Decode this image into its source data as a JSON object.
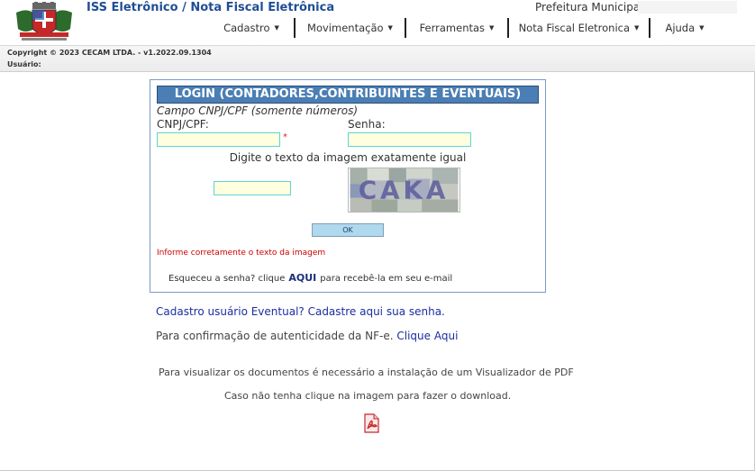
{
  "header": {
    "app_title": "ISS Eletrônico / Nota Fiscal Eletrônica",
    "prefeitura_label": "Prefeitura Municipal",
    "menu": [
      {
        "label": "Cadastro"
      },
      {
        "label": "Movimentação"
      },
      {
        "label": "Ferramentas"
      },
      {
        "label": "Nota Fiscal Eletronica"
      },
      {
        "label": "Ajuda"
      }
    ]
  },
  "statusbar": {
    "copyright": "Copyright © 2023 CECAM LTDA. - v1.2022.09.1304",
    "user_label": "Usuário:"
  },
  "login": {
    "title": "LOGIN (CONTADORES,CONTRIBUINTES E EVENTUAIS)",
    "cnpj_hint": "Campo CNPJ/CPF (somente números)",
    "cnpj_label": "CNPJ/CPF:",
    "cnpj_value": "",
    "required_mark": "*",
    "senha_label": "Senha:",
    "senha_value": "",
    "captcha_label": "Digite o texto da imagem exatamente igual",
    "captcha_value": "",
    "captcha_image_text": "CAKA",
    "ok_label": "OK",
    "error_message": "Informe corretamente o texto da imagem",
    "forgot_prefix": "Esqueceu a senha? clique",
    "forgot_link": "AQUI",
    "forgot_suffix": "para recebê-la em seu e-mail"
  },
  "links": {
    "cadastro_eventual": "Cadastro usuário Eventual? Cadastre aqui sua senha.",
    "confirm_prefix": "Para confirmação de autenticidade da NF-e.",
    "confirm_link": "Clique Aqui"
  },
  "pdf": {
    "line1": "Para visualizar os documentos é necessário a instalação de um Visualizador de PDF",
    "line2": "Caso não tenha clique na imagem para fazer o download.",
    "icon": "pdf-icon"
  },
  "colors": {
    "title_blue": "#1f4e96",
    "login_header": "#4a7eb4",
    "field_bg": "#ffffe0",
    "field_border": "#5fd3d3",
    "link_blue": "#1a2ea0",
    "error_red": "#cc0000"
  }
}
